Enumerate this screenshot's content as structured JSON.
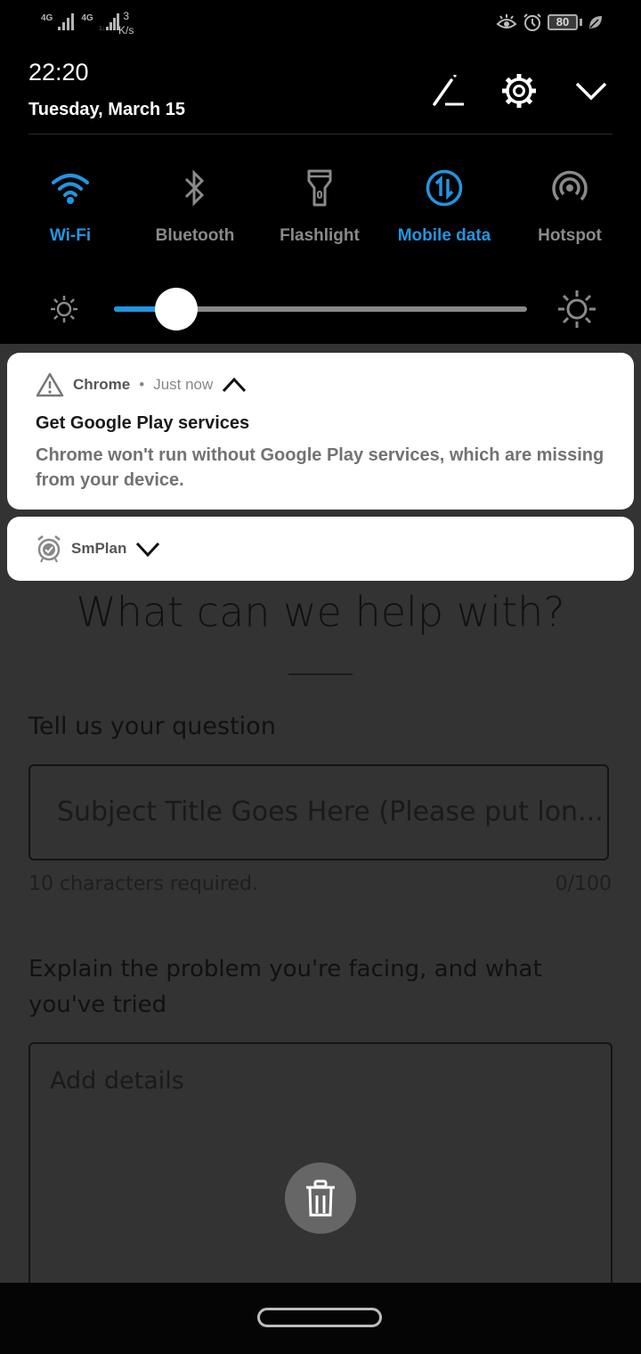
{
  "status_bar": {
    "sim1_network": "4G",
    "sim2_network": "4G",
    "speed_value": "3",
    "speed_unit": "K/s",
    "battery_level": "80",
    "icons": [
      "eye-comfort-icon",
      "alarm-icon",
      "battery-icon",
      "power-saving-leaf-icon"
    ]
  },
  "shade": {
    "time": "22:20",
    "date": "Tuesday, March 15",
    "header_icons": [
      "edit-pencil-icon",
      "settings-gear-icon",
      "collapse-chevron-icon"
    ],
    "tiles": [
      {
        "label": "Wi-Fi",
        "icon": "wifi-icon",
        "active": true
      },
      {
        "label": "Bluetooth",
        "icon": "bluetooth-icon",
        "active": false
      },
      {
        "label": "Flashlight",
        "icon": "flashlight-icon",
        "active": false
      },
      {
        "label": "Mobile data",
        "icon": "mobile-data-icon",
        "active": true
      },
      {
        "label": "Hotspot",
        "icon": "hotspot-icon",
        "active": false
      }
    ],
    "brightness_fraction": 0.15,
    "accent_color": "#2196e0"
  },
  "notifications": [
    {
      "app": "Chrome",
      "separator": "•",
      "time": "Just now",
      "icon": "warning-triangle-icon",
      "expanded": true,
      "title": "Get Google Play services",
      "body": "Chrome won't run without Google Play services, which are missing from your device."
    },
    {
      "app": "SmPlan",
      "icon": "alarm-clock-check-icon",
      "expanded": false
    }
  ],
  "app": {
    "title": "What can we help with?",
    "question_label": "Tell us your question",
    "subject_placeholder": "Subject Title Goes Here (Please put lon...",
    "helper_text": "10 characters required.",
    "char_counter": "0/100",
    "explain_label": "Explain the problem you're facing, and what you've tried",
    "details_placeholder": "Add details",
    "delete_icon": "trash-icon"
  }
}
